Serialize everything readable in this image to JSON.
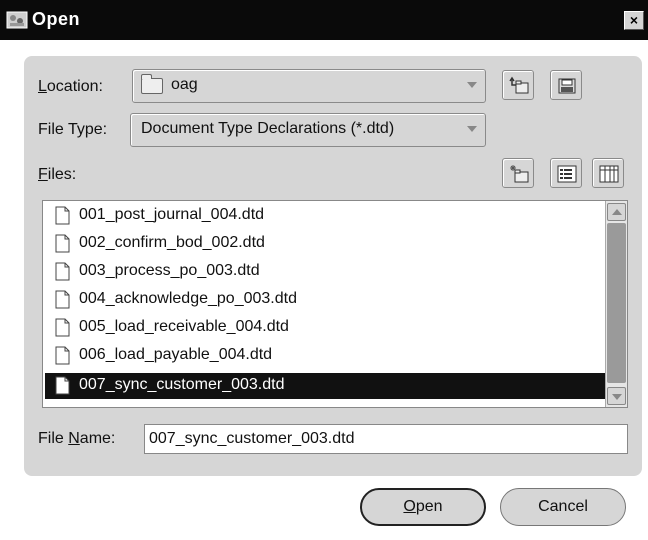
{
  "window": {
    "title": "Open",
    "close_label": "×"
  },
  "location": {
    "label_pre": "",
    "label_mnemonic": "L",
    "label_post": "ocation:",
    "value": "oag"
  },
  "file_type": {
    "label": "File Type:",
    "value": "Document Type Declarations (*.dtd)"
  },
  "files": {
    "label_mnemonic": "F",
    "label_post": "iles:",
    "items": [
      {
        "name": "001_post_journal_004.dtd"
      },
      {
        "name": "002_confirm_bod_002.dtd"
      },
      {
        "name": "003_process_po_003.dtd"
      },
      {
        "name": "004_acknowledge_po_003.dtd"
      },
      {
        "name": "005_load_receivable_004.dtd"
      },
      {
        "name": "006_load_payable_004.dtd"
      },
      {
        "name": "007_sync_customer_003.dtd"
      }
    ],
    "selected_index": 6
  },
  "file_name": {
    "label_pre": "File ",
    "label_mnemonic": "N",
    "label_post": "ame:",
    "value": "007_sync_customer_003.dtd"
  },
  "buttons": {
    "open_mnemonic": "O",
    "open_post": "pen",
    "cancel": "Cancel"
  }
}
